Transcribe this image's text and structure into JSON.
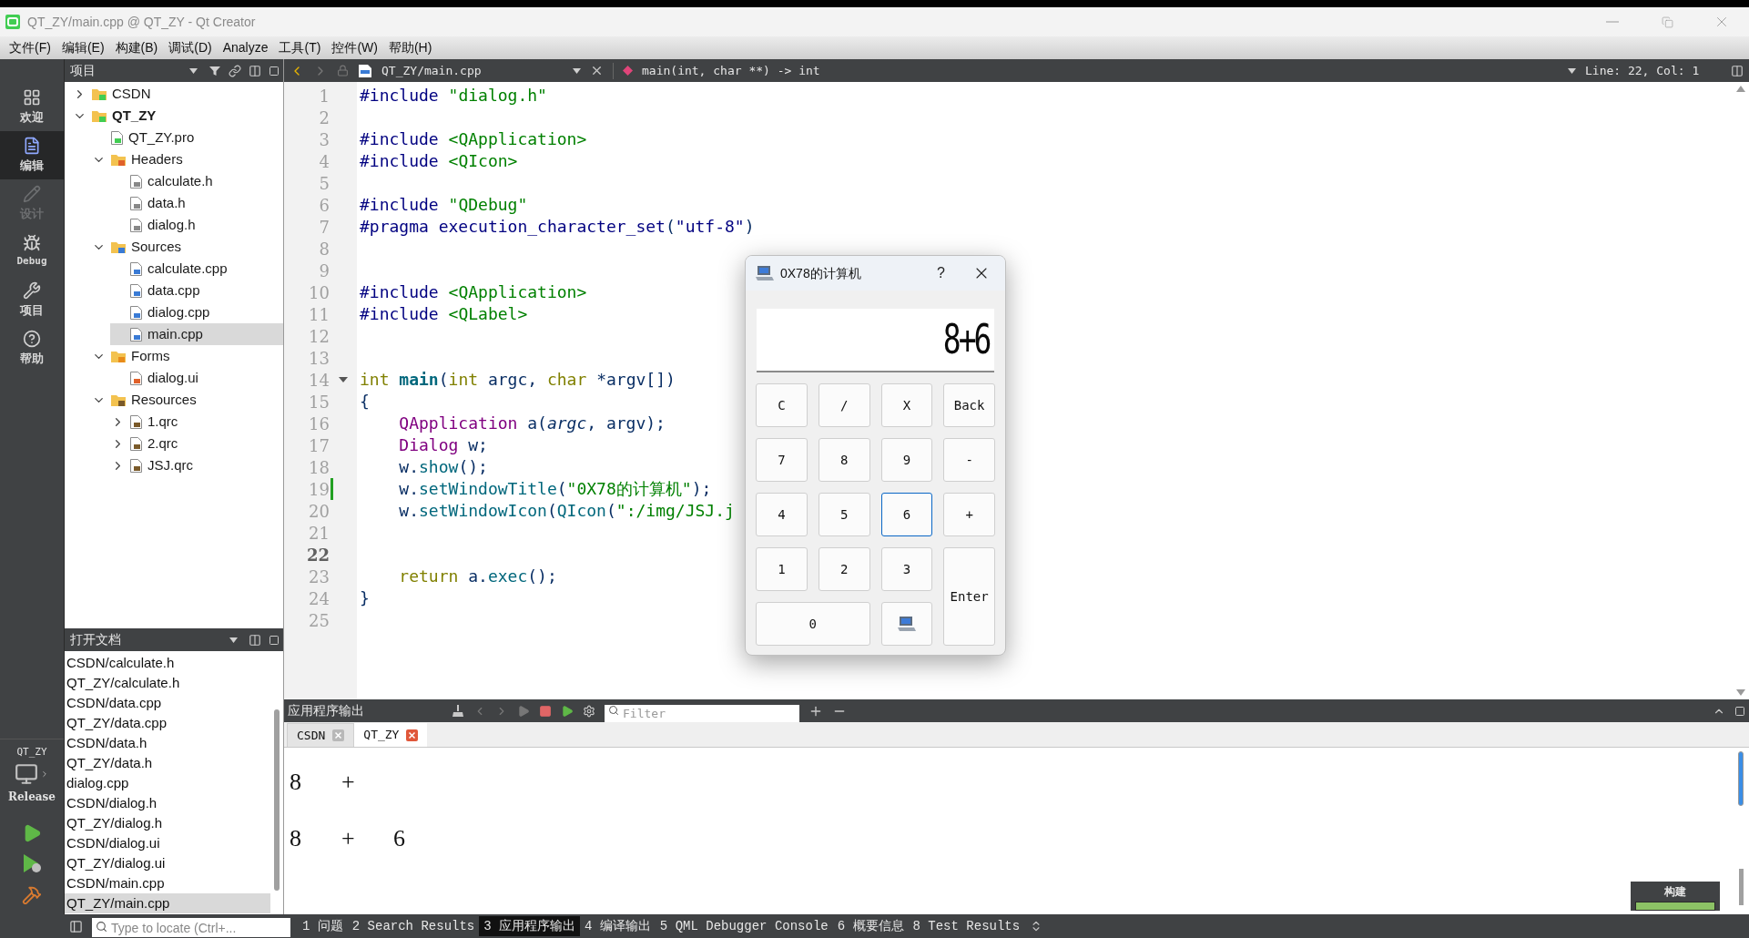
{
  "window": {
    "title": "QT_ZY/main.cpp @ QT_ZY - Qt Creator"
  },
  "menu": [
    "文件(F)",
    "编辑(E)",
    "构建(B)",
    "调试(D)",
    "Analyze",
    "工具(T)",
    "控件(W)",
    "帮助(H)"
  ],
  "mode_bar": {
    "items": [
      {
        "label": "欢迎",
        "kind": "welcome",
        "selected": false,
        "disabled": false
      },
      {
        "label": "编辑",
        "kind": "edit",
        "selected": true,
        "disabled": false
      },
      {
        "label": "设计",
        "kind": "design",
        "selected": false,
        "disabled": true
      },
      {
        "label": "Debug",
        "kind": "debug",
        "selected": false,
        "disabled": false
      },
      {
        "label": "项目",
        "kind": "projects",
        "selected": false,
        "disabled": false
      },
      {
        "label": "帮助",
        "kind": "help",
        "selected": false,
        "disabled": false
      }
    ],
    "kit": {
      "project": "QT_ZY",
      "build": "Release"
    }
  },
  "project_panel": {
    "title": "项目",
    "tree": [
      {
        "label": "CSDN",
        "kind": "project",
        "expanded": false,
        "active": false,
        "selected": false
      },
      {
        "label": "QT_ZY",
        "kind": "project",
        "expanded": true,
        "active": true,
        "selected": false,
        "children": [
          {
            "label": "QT_ZY.pro",
            "kind": "pro",
            "selected": false
          },
          {
            "label": "Headers",
            "kind": "headers",
            "expanded": true,
            "selected": false,
            "children": [
              {
                "label": "calculate.h",
                "kind": "h",
                "selected": false
              },
              {
                "label": "data.h",
                "kind": "h",
                "selected": false
              },
              {
                "label": "dialog.h",
                "kind": "h",
                "selected": false
              }
            ]
          },
          {
            "label": "Sources",
            "kind": "sources",
            "expanded": true,
            "selected": false,
            "children": [
              {
                "label": "calculate.cpp",
                "kind": "cpp",
                "selected": false
              },
              {
                "label": "data.cpp",
                "kind": "cpp",
                "selected": false
              },
              {
                "label": "dialog.cpp",
                "kind": "cpp",
                "selected": false
              },
              {
                "label": "main.cpp",
                "kind": "cpp",
                "selected": true
              }
            ]
          },
          {
            "label": "Forms",
            "kind": "forms",
            "expanded": true,
            "selected": false,
            "children": [
              {
                "label": "dialog.ui",
                "kind": "ui",
                "selected": false
              }
            ]
          },
          {
            "label": "Resources",
            "kind": "resources",
            "expanded": true,
            "selected": false,
            "children": [
              {
                "label": "1.qrc",
                "kind": "qrc",
                "expanded": false,
                "selected": false
              },
              {
                "label": "2.qrc",
                "kind": "qrc",
                "expanded": false,
                "selected": false
              },
              {
                "label": "JSJ.qrc",
                "kind": "qrc",
                "expanded": false,
                "selected": false
              }
            ]
          }
        ]
      }
    ]
  },
  "open_documents": {
    "title": "打开文档",
    "items": [
      {
        "label": "CSDN/calculate.h",
        "selected": false
      },
      {
        "label": "QT_ZY/calculate.h",
        "selected": false
      },
      {
        "label": "CSDN/data.cpp",
        "selected": false
      },
      {
        "label": "QT_ZY/data.cpp",
        "selected": false
      },
      {
        "label": "CSDN/data.h",
        "selected": false
      },
      {
        "label": "QT_ZY/data.h",
        "selected": false
      },
      {
        "label": "dialog.cpp",
        "selected": false
      },
      {
        "label": "CSDN/dialog.h",
        "selected": false
      },
      {
        "label": "QT_ZY/dialog.h",
        "selected": false
      },
      {
        "label": "CSDN/dialog.ui",
        "selected": false
      },
      {
        "label": "QT_ZY/dialog.ui",
        "selected": false
      },
      {
        "label": "CSDN/main.cpp",
        "selected": false
      },
      {
        "label": "QT_ZY/main.cpp",
        "selected": true
      }
    ]
  },
  "editor": {
    "file": "QT_ZY/main.cpp",
    "symbol": "main(int, char **) -> int",
    "position": "Line: 22, Col: 1",
    "lines": [
      {
        "number": "1",
        "current": false,
        "modified": false,
        "foldable": false,
        "tokens": [
          {
            "text": "#include ",
            "kind": "preproc"
          },
          {
            "text": "\"dialog.h\"",
            "kind": "string"
          }
        ]
      },
      {
        "number": "2",
        "current": false,
        "modified": false,
        "foldable": false
      },
      {
        "number": "3",
        "current": false,
        "modified": false,
        "foldable": false,
        "tokens": [
          {
            "text": "#include ",
            "kind": "preproc"
          },
          {
            "text": "<QApplication>",
            "kind": "string"
          }
        ]
      },
      {
        "number": "4",
        "current": false,
        "modified": false,
        "foldable": false,
        "tokens": [
          {
            "text": "#include ",
            "kind": "preproc"
          },
          {
            "text": "<QIcon>",
            "kind": "string"
          }
        ]
      },
      {
        "number": "5",
        "current": false,
        "modified": false,
        "foldable": false
      },
      {
        "number": "6",
        "current": false,
        "modified": false,
        "foldable": false,
        "tokens": [
          {
            "text": "#include ",
            "kind": "preproc"
          },
          {
            "text": "\"QDebug\"",
            "kind": "string"
          }
        ]
      },
      {
        "number": "7",
        "current": false,
        "modified": false,
        "foldable": false,
        "tokens": [
          {
            "text": "#pragma execution_character_set",
            "kind": "preproc"
          },
          {
            "text": "(",
            "kind": "plain"
          },
          {
            "text": "\"utf-8\"",
            "kind": "preproc"
          },
          {
            "text": ")",
            "kind": "plain"
          }
        ]
      },
      {
        "number": "8",
        "current": false,
        "modified": false,
        "foldable": false
      },
      {
        "number": "9",
        "current": false,
        "modified": false,
        "foldable": false
      },
      {
        "number": "10",
        "current": false,
        "modified": false,
        "foldable": false,
        "tokens": [
          {
            "text": "#include ",
            "kind": "preproc"
          },
          {
            "text": "<QApplication>",
            "kind": "string"
          }
        ]
      },
      {
        "number": "11",
        "current": false,
        "modified": false,
        "foldable": false,
        "tokens": [
          {
            "text": "#include ",
            "kind": "preproc"
          },
          {
            "text": "<QLabel>",
            "kind": "string"
          }
        ]
      },
      {
        "number": "12",
        "current": false,
        "modified": false,
        "foldable": false
      },
      {
        "number": "13",
        "current": false,
        "modified": false,
        "foldable": false
      },
      {
        "number": "14",
        "current": false,
        "modified": false,
        "foldable": true,
        "tokens": [
          {
            "text": "int ",
            "kind": "keyword"
          },
          {
            "text": "main",
            "kind": "function"
          },
          {
            "text": "(",
            "kind": "plain"
          },
          {
            "text": "int",
            "kind": "keyword"
          },
          {
            "text": " argc, ",
            "kind": "plain"
          },
          {
            "text": "char",
            "kind": "keyword"
          },
          {
            "text": " *argv[])",
            "kind": "plain"
          }
        ]
      },
      {
        "number": "15",
        "current": false,
        "modified": false,
        "foldable": false,
        "tokens": [
          {
            "text": "{",
            "kind": "plain"
          }
        ]
      },
      {
        "number": "16",
        "current": false,
        "modified": false,
        "foldable": false,
        "tokens": [
          {
            "text": "    QApplication",
            "kind": "type"
          },
          {
            "text": " a(",
            "kind": "plain"
          },
          {
            "text": "argc",
            "kind": "param"
          },
          {
            "text": ", argv);",
            "kind": "plain"
          }
        ]
      },
      {
        "number": "17",
        "current": false,
        "modified": false,
        "foldable": false,
        "tokens": [
          {
            "text": "    Dialog",
            "kind": "type"
          },
          {
            "text": " w;",
            "kind": "plain"
          }
        ]
      },
      {
        "number": "18",
        "current": false,
        "modified": false,
        "foldable": false,
        "tokens": [
          {
            "text": "    w.",
            "kind": "plain"
          },
          {
            "text": "show",
            "kind": "call"
          },
          {
            "text": "();",
            "kind": "plain"
          }
        ]
      },
      {
        "number": "19",
        "current": false,
        "modified": true,
        "foldable": false,
        "tokens": [
          {
            "text": "    w.",
            "kind": "plain"
          },
          {
            "text": "setWindowTitle",
            "kind": "call"
          },
          {
            "text": "(",
            "kind": "plain"
          },
          {
            "text": "\"0X78的计算机\"",
            "kind": "string"
          },
          {
            "text": ");",
            "kind": "plain"
          }
        ]
      },
      {
        "number": "20",
        "current": false,
        "modified": false,
        "foldable": false,
        "tokens": [
          {
            "text": "    w.",
            "kind": "plain"
          },
          {
            "text": "setWindowIcon",
            "kind": "call"
          },
          {
            "text": "(",
            "kind": "plain"
          },
          {
            "text": "QIcon",
            "kind": "call"
          },
          {
            "text": "(",
            "kind": "plain"
          },
          {
            "text": "\":/img/JSJ.j",
            "kind": "string"
          }
        ]
      },
      {
        "number": "21",
        "current": false,
        "modified": false,
        "foldable": false
      },
      {
        "number": "22",
        "current": true,
        "modified": false,
        "foldable": false
      },
      {
        "number": "23",
        "current": false,
        "modified": false,
        "foldable": false,
        "tokens": [
          {
            "text": "    return",
            "kind": "keyword"
          },
          {
            "text": " a.",
            "kind": "plain"
          },
          {
            "text": "exec",
            "kind": "call"
          },
          {
            "text": "();",
            "kind": "plain"
          }
        ]
      },
      {
        "number": "24",
        "current": false,
        "modified": false,
        "foldable": false,
        "tokens": [
          {
            "text": "}",
            "kind": "plain"
          }
        ]
      },
      {
        "number": "25",
        "current": false,
        "modified": false,
        "foldable": false
      }
    ]
  },
  "dialog": {
    "title": "0X78的计算机",
    "help": "?",
    "display": "8+6",
    "keys": [
      {
        "label": "C",
        "kind": "key",
        "focused": false
      },
      {
        "label": "/",
        "kind": "key",
        "focused": false
      },
      {
        "label": "X",
        "kind": "key",
        "focused": false
      },
      {
        "label": "Back",
        "kind": "key",
        "focused": false
      },
      {
        "label": "7",
        "kind": "key",
        "focused": false
      },
      {
        "label": "8",
        "kind": "key",
        "focused": false
      },
      {
        "label": "9",
        "kind": "key",
        "focused": false
      },
      {
        "label": "-",
        "kind": "key",
        "focused": false
      },
      {
        "label": "4",
        "kind": "key",
        "focused": false
      },
      {
        "label": "5",
        "kind": "key",
        "focused": false
      },
      {
        "label": "6",
        "kind": "key",
        "focused": true
      },
      {
        "label": "+",
        "kind": "key",
        "focused": false
      },
      {
        "label": "1",
        "kind": "key",
        "focused": false
      },
      {
        "label": "2",
        "kind": "key",
        "focused": false
      },
      {
        "label": "3",
        "kind": "key",
        "focused": false
      },
      {
        "label": "Enter",
        "kind": "tall",
        "focused": false
      },
      {
        "label": "0",
        "kind": "wide",
        "focused": false
      },
      {
        "kind": "icon",
        "focused": false
      }
    ]
  },
  "output": {
    "title": "应用程序输出",
    "filter_placeholder": "Filter",
    "tabs": [
      {
        "label": "CSDN",
        "selected": false
      },
      {
        "label": "QT_ZY",
        "selected": true
      }
    ],
    "lines": [
      [
        "8",
        "+"
      ],
      [
        "8",
        "+",
        "6"
      ]
    ]
  },
  "build_status": {
    "label": "构建",
    "level": 1
  },
  "status_bar": {
    "locator_placeholder": "Type to locate (Ctrl+...",
    "panes": [
      {
        "label": "1 问题",
        "selected": false
      },
      {
        "label": "2 Search Results",
        "selected": false
      },
      {
        "label": "3 应用程序输出",
        "selected": true
      },
      {
        "label": "4 编译输出",
        "selected": false
      },
      {
        "label": "5 QML Debugger Console",
        "selected": false
      },
      {
        "label": "6 概要信息",
        "selected": false
      },
      {
        "label": "8 Test Results",
        "selected": false
      }
    ]
  }
}
